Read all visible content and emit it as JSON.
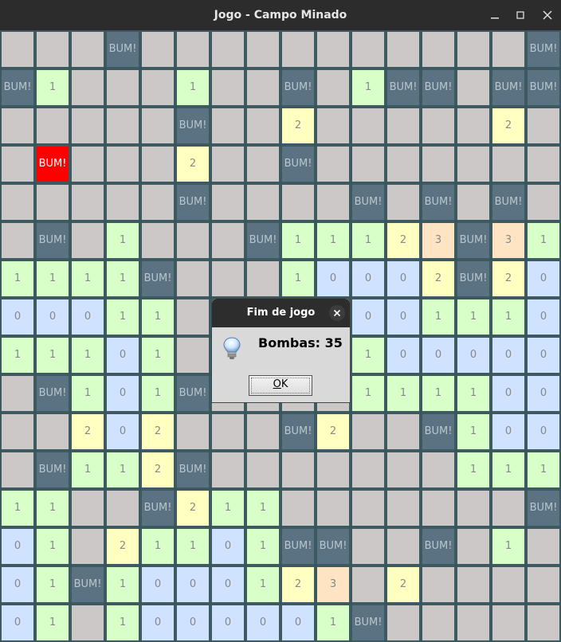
{
  "window": {
    "title": "Jogo - Campo Minado",
    "minimize_icon": "minimize-icon",
    "maximize_icon": "maximize-icon",
    "close_icon": "close-icon"
  },
  "colors": {
    "unrevealed": "#cdc8c8",
    "bomb": "#5a7281",
    "exploded": "#ff0000",
    "zero": "#cfe2ff",
    "one": "#d8ffc8",
    "two": "#ffffc0",
    "three": "#ffe4c4",
    "grid_line": "#3c5a60"
  },
  "board": {
    "rows": 16,
    "cols": 16,
    "bomb_label": "BUM!",
    "cells": [
      [
        "",
        "",
        "",
        "B",
        "",
        "",
        "",
        "",
        "",
        "",
        "",
        "",
        "",
        "",
        "",
        "B"
      ],
      [
        "B",
        "1",
        "",
        "",
        "",
        "1",
        "",
        "",
        "B",
        "",
        "1",
        "B",
        "B",
        "",
        "B",
        "B"
      ],
      [
        "",
        "",
        "",
        "",
        "",
        "B",
        "",
        "",
        "2",
        "",
        "",
        "",
        "",
        "",
        "2",
        ""
      ],
      [
        "",
        "X",
        "",
        "",
        "",
        "2",
        "",
        "",
        "B",
        "",
        "",
        "",
        "",
        "",
        "",
        ""
      ],
      [
        "",
        "",
        "",
        "",
        "",
        "B",
        "",
        "",
        "",
        "",
        "B",
        "",
        "B",
        "",
        "B",
        ""
      ],
      [
        "",
        "B",
        "",
        "1",
        "",
        "",
        "",
        "B",
        "1",
        "1",
        "1",
        "2",
        "3",
        "B",
        "3",
        "1"
      ],
      [
        "1",
        "1",
        "1",
        "1",
        "B",
        "",
        "",
        "",
        "1",
        "0",
        "0",
        "0",
        "2",
        "B",
        "2",
        "0"
      ],
      [
        "0",
        "0",
        "0",
        "1",
        "1",
        "",
        "",
        "",
        "",
        "",
        "0",
        "0",
        "1",
        "1",
        "1",
        "0"
      ],
      [
        "1",
        "1",
        "1",
        "0",
        "1",
        "",
        "",
        "",
        "",
        "",
        "1",
        "0",
        "0",
        "0",
        "0",
        "0"
      ],
      [
        "",
        "B",
        "1",
        "0",
        "1",
        "B",
        "",
        "",
        "",
        "",
        "1",
        "1",
        "1",
        "1",
        "0",
        "0"
      ],
      [
        "",
        "",
        "2",
        "0",
        "2",
        "",
        "",
        "",
        "B",
        "2",
        "",
        "",
        "B",
        "1",
        "0",
        "0"
      ],
      [
        "",
        "B",
        "1",
        "1",
        "2",
        "B",
        "",
        "",
        "",
        "",
        "",
        "",
        "",
        "1",
        "1",
        "1"
      ],
      [
        "1",
        "1",
        "",
        "",
        "B",
        "2",
        "1",
        "1",
        "",
        "",
        "",
        "",
        "",
        "",
        "",
        "B"
      ],
      [
        "0",
        "1",
        "",
        "2",
        "1",
        "1",
        "0",
        "1",
        "B",
        "B",
        "",
        "",
        "B",
        "",
        "1",
        ""
      ],
      [
        "0",
        "1",
        "B",
        "1",
        "0",
        "0",
        "0",
        "1",
        "2",
        "3",
        "",
        "2",
        "",
        "",
        "",
        ""
      ],
      [
        "0",
        "1",
        "",
        "1",
        "0",
        "0",
        "0",
        "0",
        "0",
        "1",
        "B",
        "",
        "",
        "",
        "",
        ""
      ]
    ]
  },
  "dialog": {
    "title": "Fim de jogo",
    "message": "Bombas: 35",
    "ok_prefix": "O",
    "ok_rest": "K",
    "info_icon": "lightbulb-icon",
    "close_icon": "close-icon"
  }
}
